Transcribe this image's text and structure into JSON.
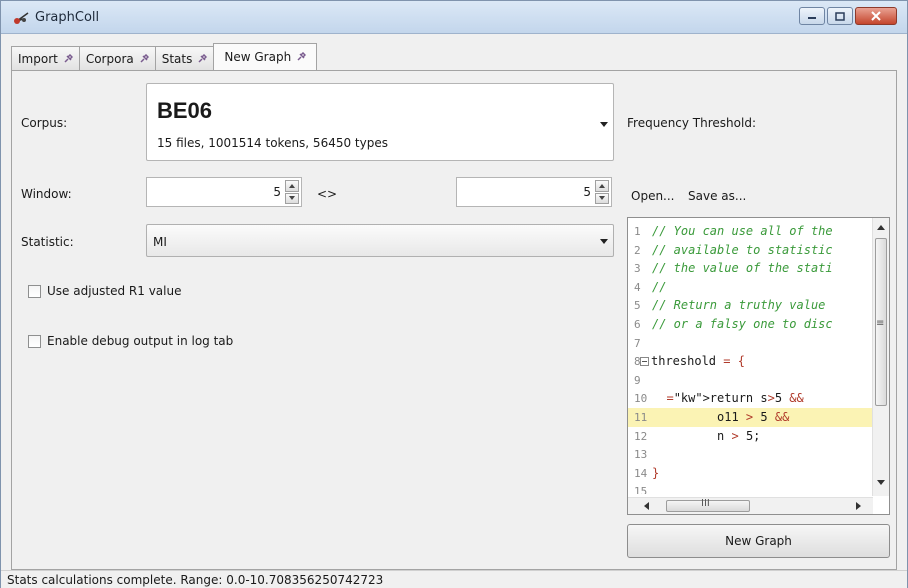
{
  "window": {
    "title": "GraphColl"
  },
  "tabs": [
    {
      "label": "Import"
    },
    {
      "label": "Corpora"
    },
    {
      "label": "Stats"
    },
    {
      "label": "New Graph"
    }
  ],
  "form": {
    "corpus_label": "Corpus:",
    "corpus_name": "BE06",
    "corpus_info": "15 files, 1001514 tokens, 56450 types",
    "window_label": "Window:",
    "window_left": "5",
    "window_sep": "<>",
    "window_right": "5",
    "statistic_label": "Statistic:",
    "statistic_value": "MI",
    "adjusted_r1": "Use adjusted R1 value",
    "debug_output": "Enable debug output in log tab"
  },
  "right": {
    "freq_threshold_label": "Frequency Threshold:",
    "open_link": "Open...",
    "save_as_link": "Save as...",
    "new_graph_button": "New Graph"
  },
  "editor": {
    "lines": [
      {
        "n": "1",
        "text": "// You can use all of the"
      },
      {
        "n": "2",
        "text": "// available to statistic"
      },
      {
        "n": "3",
        "text": "// the value of the stati"
      },
      {
        "n": "4",
        "text": "//"
      },
      {
        "n": "5",
        "text": "// Return a truthy value"
      },
      {
        "n": "6",
        "text": "// or a falsy one to disc"
      },
      {
        "n": "7",
        "text": ""
      },
      {
        "n": "8",
        "text": "threshold = {"
      },
      {
        "n": "9",
        "text": ""
      },
      {
        "n": "10",
        "text": "  return s>5 &&"
      },
      {
        "n": "11",
        "text": "         o11 > 5 &&"
      },
      {
        "n": "12",
        "text": "         n > 5;"
      },
      {
        "n": "13",
        "text": ""
      },
      {
        "n": "14",
        "text": "}"
      },
      {
        "n": "15",
        "text": ""
      }
    ],
    "highlighted_line": "11"
  },
  "status": {
    "text": "Stats calculations complete.  Range: 0.0-10.708356250742723"
  }
}
